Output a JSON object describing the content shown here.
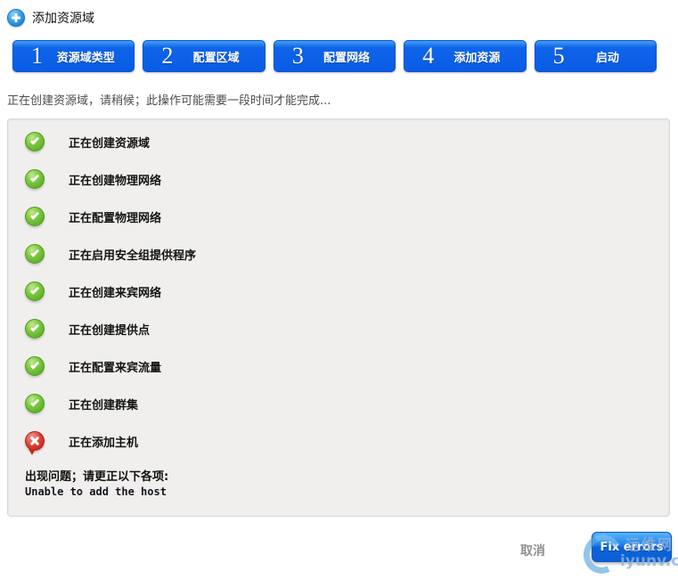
{
  "header": {
    "title": "添加资源域"
  },
  "steps": [
    {
      "number": "1",
      "label": "资源域类型"
    },
    {
      "number": "2",
      "label": "配置区域"
    },
    {
      "number": "3",
      "label": "配置网络"
    },
    {
      "number": "4",
      "label": "添加资源"
    },
    {
      "number": "5",
      "label": "启动"
    }
  ],
  "progress": {
    "message": "正在创建资源域，请稍候；此操作可能需要一段时间才能完成...",
    "items": [
      {
        "label": "正在创建资源域",
        "status": "success"
      },
      {
        "label": "正在创建物理网络",
        "status": "success"
      },
      {
        "label": "正在配置物理网络",
        "status": "success"
      },
      {
        "label": "正在启用安全组提供程序",
        "status": "success"
      },
      {
        "label": "正在创建来宾网络",
        "status": "success"
      },
      {
        "label": "正在创建提供点",
        "status": "success"
      },
      {
        "label": "正在配置来宾流量",
        "status": "success"
      },
      {
        "label": "正在创建群集",
        "status": "success"
      },
      {
        "label": "正在添加主机",
        "status": "error"
      }
    ],
    "error_title": "出现问题；请更正以下各项:",
    "error_detail": "Unable to add the host"
  },
  "footer": {
    "cancel_label": "取消",
    "fix_errors_label": "Fix errors"
  },
  "watermark": {
    "site_name": "运维网",
    "domain": "iyunv.com"
  },
  "colors": {
    "step_button_blue": "#0d62ea",
    "success_green": "#5cb52b",
    "error_red": "#d5352b",
    "action_blue": "#1372e0",
    "panel_gray": "#f0efed"
  }
}
